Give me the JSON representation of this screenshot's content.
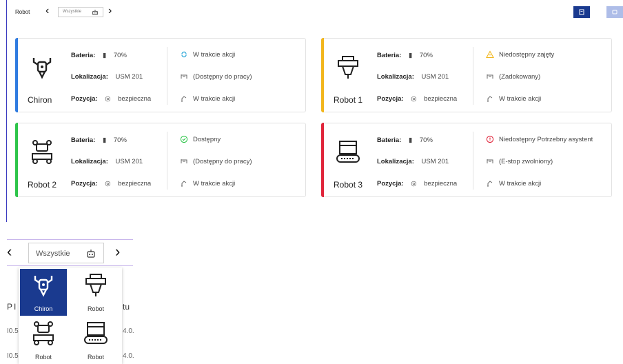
{
  "topbar": {
    "title": "Robot",
    "filter_value": "Wszystkie"
  },
  "labels": {
    "battery": "Bateria:",
    "location": "Lokalizacja:",
    "position": "Pozycja:"
  },
  "cards": [
    {
      "name": "Chiron",
      "accent": "#2f7be0",
      "battery": "70%",
      "location": "USM 201",
      "position": "bezpieczna",
      "status": "W trakcie akcji",
      "availability": "(Dostępny do pracy)",
      "action": "W trakcie akcji",
      "status_icon": "sync-icon"
    },
    {
      "name": "Robot 1",
      "accent": "#f2b61c",
      "battery": "70%",
      "location": "USM 201",
      "position": "bezpieczna",
      "status": "Niedostępny zajęty",
      "availability": "(Zadokowany)",
      "action": "W trakcie akcji",
      "status_icon": "warning-icon"
    },
    {
      "name": "Robot 2",
      "accent": "#2ec54a",
      "battery": "70%",
      "location": "USM 201",
      "position": "bezpieczna",
      "status": "Dostępny",
      "availability": "(Dostępny do pracy)",
      "action": "W trakcie akcji",
      "status_icon": "check-circle-icon"
    },
    {
      "name": "Robot 3",
      "accent": "#e0243a",
      "battery": "70%",
      "location": "USM 201",
      "position": "bezpieczna",
      "status": "Niedostępny Potrzebny asystent",
      "availability": "(E-stop zwolniony)",
      "action": "W trakcie akcji",
      "status_icon": "error-circle-icon"
    }
  ],
  "dropdown": {
    "value": "Wszystkie",
    "options": [
      "Chiron",
      "Robot",
      "Robot",
      "Robot"
    ]
  },
  "background_fragments": {
    "a": "P",
    "b": "I",
    "c": "tu",
    "d": "I0.5",
    "e": "4.0.",
    "f": "I0.5",
    "g": "4.0."
  }
}
